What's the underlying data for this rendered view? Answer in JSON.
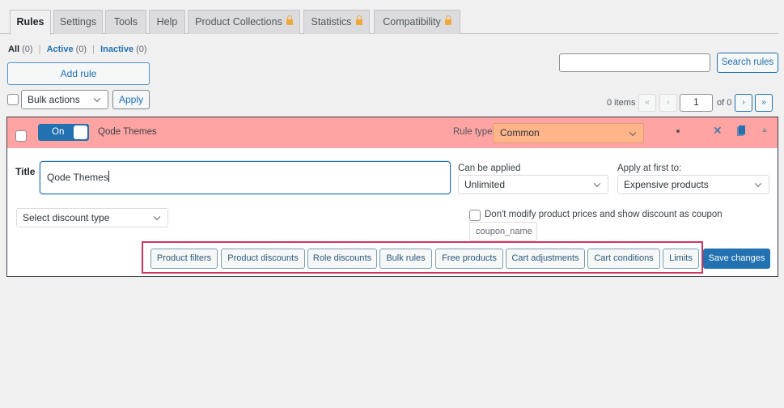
{
  "tabs": [
    {
      "label": "Rules",
      "active": true,
      "locked": false
    },
    {
      "label": "Settings",
      "active": false,
      "locked": false
    },
    {
      "label": "Tools",
      "active": false,
      "locked": false
    },
    {
      "label": "Help",
      "active": false,
      "locked": false
    },
    {
      "label": "Product Collections",
      "active": false,
      "locked": true
    },
    {
      "label": "Statistics",
      "active": false,
      "locked": true
    },
    {
      "label": "Compatibility",
      "active": false,
      "locked": true
    }
  ],
  "filters": {
    "all_label": "All",
    "all_count": "(0)",
    "active_label": "Active",
    "active_count": "(0)",
    "inactive_label": "Inactive",
    "inactive_count": "(0)",
    "separator": "|"
  },
  "toolbar": {
    "add_rule_label": "Add rule",
    "bulk_actions_value": "Bulk actions",
    "apply_label": "Apply",
    "search_value": "",
    "search_button_label": "Search rules"
  },
  "pagination": {
    "items_text": "0 items",
    "first_label": "«",
    "prev_label": "‹",
    "current_page": "1",
    "of_text": "of 0",
    "next_label": "›",
    "last_label": "»"
  },
  "rule": {
    "enabled_label": "On",
    "name": "Qode Themes",
    "rule_type_label": "Rule type",
    "rule_type_value": "Common",
    "header_color": "#ffa3a3",
    "title_label": "Title",
    "title_value": "Qode Themes",
    "can_be_applied_label": "Can be applied",
    "can_be_applied_value": "Unlimited",
    "apply_first_label": "Apply at first to:",
    "apply_first_value": "Expensive products",
    "discount_type_value": "Select discount type",
    "coupon_checkbox_label": "Don't modify product prices and show discount as coupon",
    "coupon_placeholder": "coupon_name",
    "section_buttons": [
      "Product filters",
      "Product discounts",
      "Role discounts",
      "Bulk rules",
      "Free products",
      "Cart adjustments",
      "Cart conditions",
      "Limits"
    ],
    "save_label": "Save changes"
  },
  "colors": {
    "accent": "#2271b1",
    "highlight_border": "#d2365e",
    "lock": "#f0a83a"
  }
}
